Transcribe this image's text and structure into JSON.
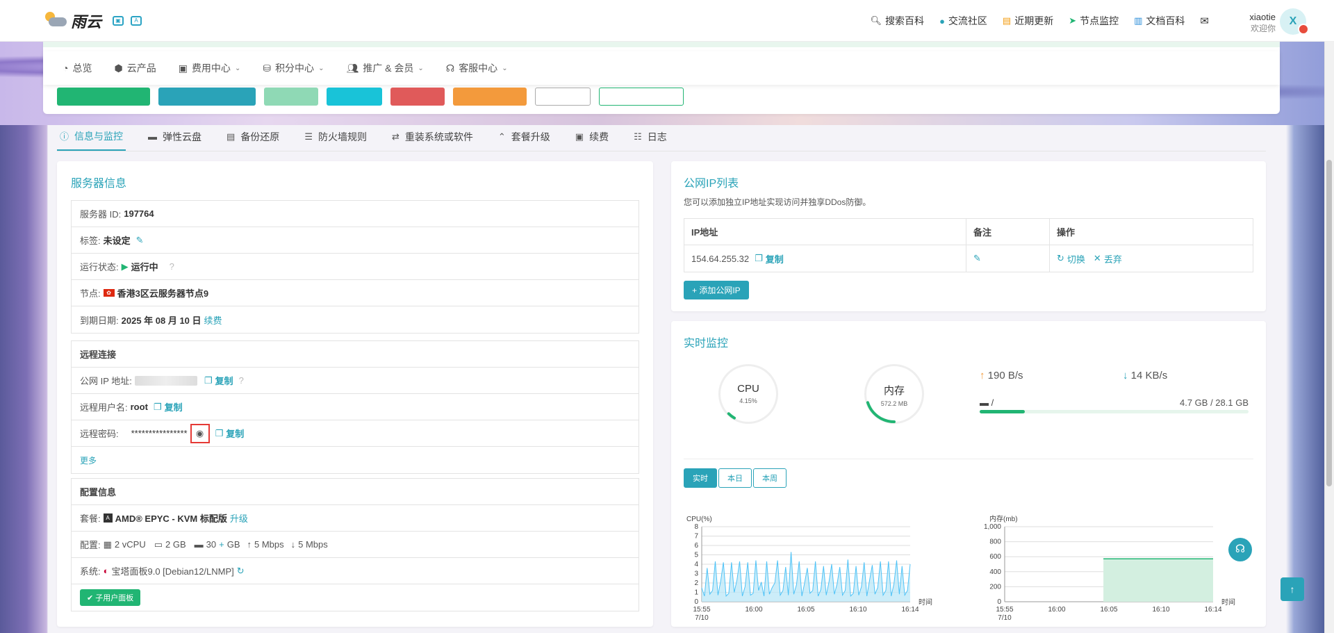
{
  "header": {
    "logo_text": "雨云",
    "nav": [
      {
        "icon": "search-icon",
        "label": "搜索百科"
      },
      {
        "icon": "community-icon",
        "label": "交流社区"
      },
      {
        "icon": "calendar-icon",
        "label": "近期更新"
      },
      {
        "icon": "send-icon",
        "label": "节点监控"
      },
      {
        "icon": "book-icon",
        "label": "文档百科"
      }
    ],
    "user_name": "xiaotie",
    "user_greeting": "欢迎你",
    "avatar_letter": "X"
  },
  "subnav": [
    {
      "label": "总览",
      "icon": "dashboard-icon"
    },
    {
      "label": "云产品",
      "icon": "cubes-icon"
    },
    {
      "label": "费用中心",
      "icon": "money-icon",
      "dropdown": true
    },
    {
      "label": "积分中心",
      "icon": "coins-icon",
      "dropdown": true
    },
    {
      "label": "推广 & 会员",
      "icon": "users-icon",
      "dropdown": true
    },
    {
      "label": "客服中心",
      "icon": "headset-icon",
      "dropdown": true
    }
  ],
  "tabs": [
    {
      "label": "信息与监控",
      "icon": "info-icon",
      "active": true
    },
    {
      "label": "弹性云盘",
      "icon": "disk-icon"
    },
    {
      "label": "备份还原",
      "icon": "backup-icon"
    },
    {
      "label": "防火墙规则",
      "icon": "list-icon"
    },
    {
      "label": "重装系统或软件",
      "icon": "swap-icon"
    },
    {
      "label": "套餐升级",
      "icon": "upgrade-icon"
    },
    {
      "label": "续费",
      "icon": "money-icon"
    },
    {
      "label": "日志",
      "icon": "log-icon"
    }
  ],
  "server": {
    "title": "服务器信息",
    "id_label": "服务器 ID:",
    "id": "197764",
    "tag_label": "标签:",
    "tag": "未设定",
    "status_label": "运行状态:",
    "status": "运行中",
    "node_label": "节点:",
    "node": "香港3区云服务器节点9",
    "expire_label": "到期日期:",
    "expire": "2025 年 08 月 10 日",
    "renew": "续费"
  },
  "remote": {
    "title": "远程连接",
    "ip_label": "公网 IP 地址:",
    "copy": "复制",
    "user_label": "远程用户名:",
    "user": "root",
    "pwd_label": "远程密码:",
    "pwd": "****************",
    "more": "更多"
  },
  "config": {
    "title": "配置信息",
    "plan_label": "套餐:",
    "plan": "AMD® EPYC - KVM 标配版",
    "upgrade": "升级",
    "spec_label": "配置:",
    "cpu": "2 vCPU",
    "ram": "2 GB",
    "disk_a": "30",
    "disk_plus": "+",
    "disk_b": " GB",
    "up": "5 Mbps",
    "down": "5 Mbps",
    "os_label": "系统:",
    "os": "宝塔面板9.0 [Debian12/LNMP]",
    "subuser_btn": "子用户面板"
  },
  "ip": {
    "title": "公网IP列表",
    "desc": "您可以添加独立IP地址实现访问并独享DDos防御。",
    "cols": [
      "IP地址",
      "备注",
      "操作"
    ],
    "rows": [
      {
        "ip": "154.64.255.32",
        "copy": "复制",
        "switch": "切换",
        "drop": "丢弃"
      }
    ],
    "add_btn": "+ 添加公网IP"
  },
  "monitor": {
    "title": "实时监控",
    "cpu_label": "CPU",
    "cpu_value": "4.15%",
    "cpu_fraction": 0.0415,
    "mem_label": "内存",
    "mem_value": "572.2 MB",
    "mem_fraction": 0.2,
    "upload": "190 B/s",
    "download": "14 KB/s",
    "disk_mount": "/",
    "disk_usage": "4.7 GB / 28.1 GB",
    "disk_fraction": 0.167,
    "ranges": [
      "实时",
      "本日",
      "本周"
    ]
  },
  "colors": {
    "accent": "#2aa3b8",
    "green": "#21b573"
  },
  "chart_data": [
    {
      "type": "area",
      "title": "",
      "ylabel": "CPU(%)",
      "xlabel": "时间",
      "ylim": [
        0,
        8
      ],
      "yticks": [
        "0",
        "1",
        "2",
        "3",
        "4",
        "5",
        "6",
        "7",
        "8"
      ],
      "xticks": [
        "15:55\n7/10",
        "16:00",
        "16:05",
        "16:10",
        "16:14"
      ],
      "x_date": "7/10",
      "values": [
        1.5,
        0.6,
        3.6,
        0.8,
        1.2,
        4.3,
        0.7,
        2.2,
        4.2,
        0.6,
        0.9,
        4.2,
        1.0,
        2.3,
        4.3,
        0.6,
        1.6,
        4.2,
        0.7,
        0.9,
        4.4,
        1.2,
        2.1,
        0.6,
        4.3,
        0.8,
        1.5,
        2.0,
        4.4,
        0.7,
        1.2,
        3.7,
        0.7,
        5.3,
        0.8,
        1.8,
        4.3,
        0.6,
        2.0,
        3.6,
        0.9,
        1.2,
        4.3,
        0.6,
        1.3,
        3.8,
        0.7,
        2.1,
        4.0,
        0.8,
        1.9,
        3.7,
        0.7,
        1.2,
        4.5,
        0.6,
        0.9,
        3.8,
        0.7,
        1.6,
        4.2,
        0.6,
        2.3,
        3.9,
        0.8,
        1.5,
        4.3,
        0.7,
        1.2,
        4.3,
        0.6,
        1.9,
        4.4,
        0.8,
        3.8,
        0.7,
        1.2,
        4.0
      ]
    },
    {
      "type": "area",
      "title": "",
      "ylabel": "内存(mb)",
      "xlabel": "时间",
      "ylim": [
        0,
        1000
      ],
      "yticks": [
        "0",
        "200",
        "400",
        "600",
        "800",
        "1,000"
      ],
      "xticks": [
        "15:55\n7/10",
        "16:00",
        "16:05",
        "16:10",
        "16:14"
      ],
      "series": [
        {
          "x_start": "16:04",
          "x_end": "16:14",
          "value": 572
        }
      ]
    }
  ]
}
